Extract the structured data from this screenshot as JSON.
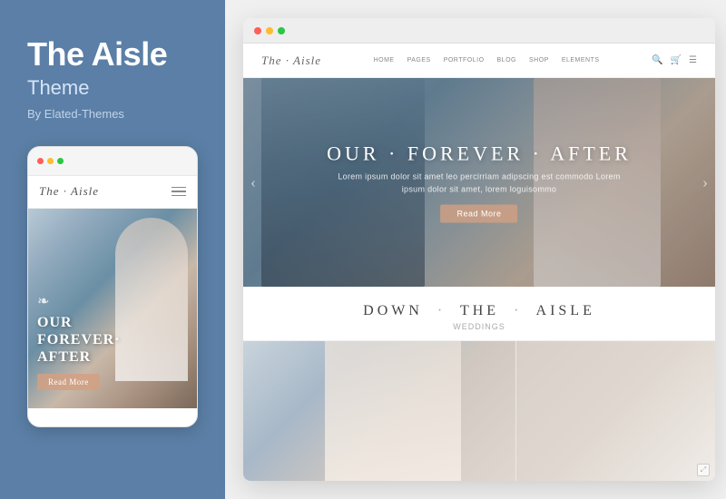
{
  "left": {
    "title": "The Aisle",
    "subtitle": "Theme",
    "author": "By Elated-Themes",
    "mobile": {
      "logo": "The · Aisle",
      "hero_title_line1": "OUR",
      "hero_title_line2": "FOREVER·",
      "hero_title_line3": "AFTER",
      "read_more": "Read More"
    }
  },
  "right": {
    "desktop": {
      "logo": "The · Aisle",
      "nav_links": [
        "HOME",
        "PAGES",
        "PORTFOLIO",
        "BLOG",
        "SHOP",
        "ELEMENTS"
      ],
      "hero_title_left": "OUR",
      "hero_title_center": "·",
      "hero_title_right": "FOREVER",
      "hero_title2_left": "AFTER",
      "hero_subtitle": "Lorem ipsum dolor sit amet leo percirriam adipscing est commodo\nLorem ipsum dolor sit amet, lorem loguisommo",
      "read_more": "Read More",
      "section_title_left": "DOWN",
      "section_title_middle": "·",
      "section_title_right": "THE",
      "section_title_end": "·",
      "section_title_last": "AISLE",
      "section_sub": "Weddings"
    }
  }
}
